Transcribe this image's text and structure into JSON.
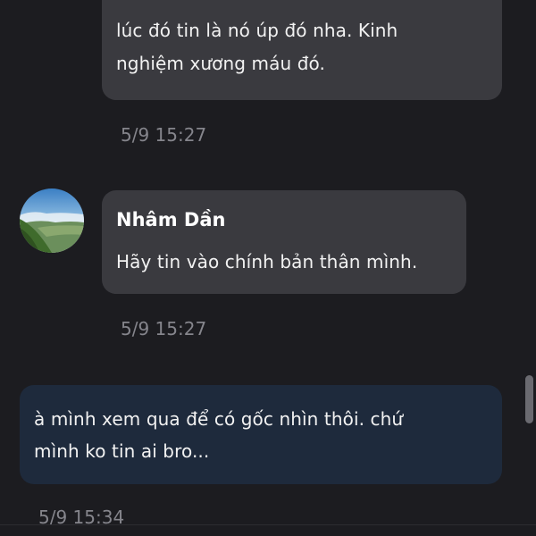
{
  "messages": [
    {
      "text": "lúc đó tin là nó úp đó nha. Kinh\nnghiệm xương máu đó.",
      "time": "5/9 15:27"
    },
    {
      "sender": "Nhâm Dần",
      "text": "Hãy tin vào chính bản thân mình.",
      "time": "5/9 15:27",
      "avatar": "landscape-photo"
    },
    {
      "text": "à mình xem qua để có gốc nhìn thôi. chứ\nmình ko tin ai bro...",
      "time": "5/9 15:34"
    }
  ],
  "colors": {
    "background": "#1c1c20",
    "incoming_bubble": "#3a3a3f",
    "outgoing_bubble": "#1e2a3c",
    "timestamp": "#85858c",
    "text": "#f2f2f2"
  }
}
